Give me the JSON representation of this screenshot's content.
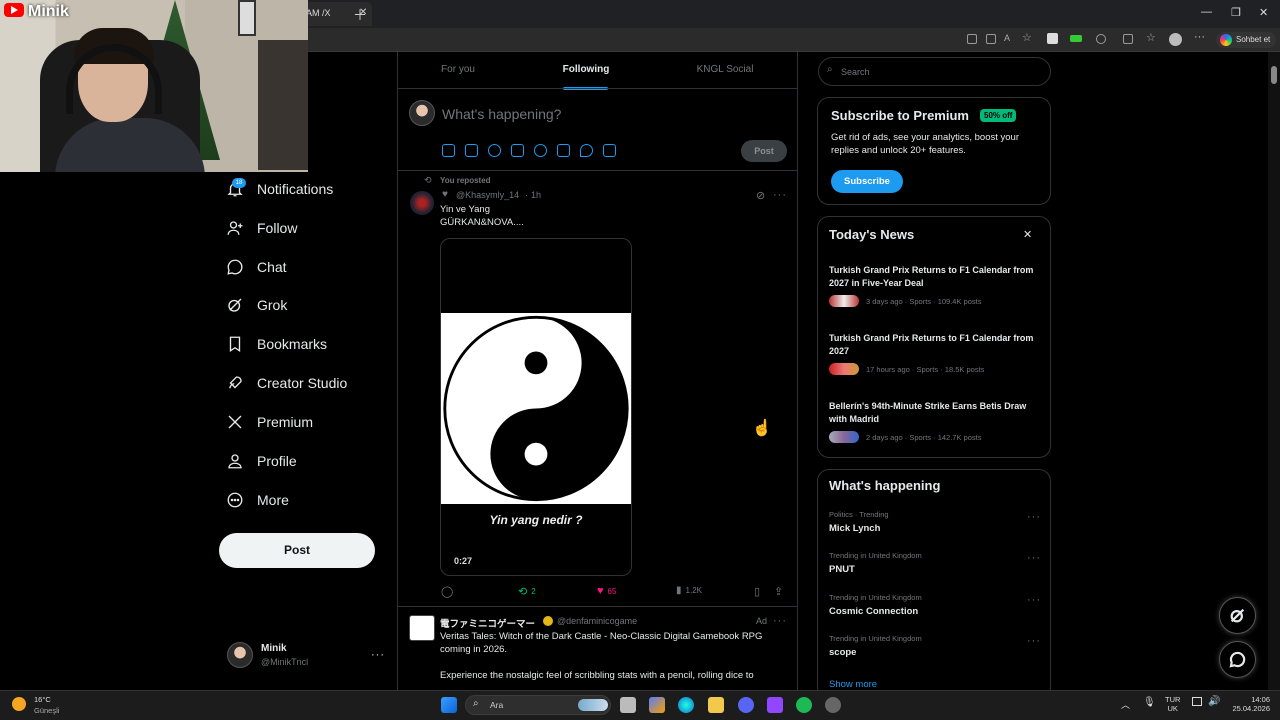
{
  "browser": {
    "tab_title": "AM /X",
    "copilot_label": "Sohbet et"
  },
  "stream": {
    "channel_name": "Minik"
  },
  "left_nav": {
    "items": [
      {
        "label": "Notifications",
        "icon": "bell-icon"
      },
      {
        "label": "Follow",
        "icon": "person-plus-icon"
      },
      {
        "label": "Chat",
        "icon": "chat-bubble-icon"
      },
      {
        "label": "Grok",
        "icon": "grok-icon"
      },
      {
        "label": "Bookmarks",
        "icon": "bookmark-icon"
      },
      {
        "label": "Creator Studio",
        "icon": "rocket-icon"
      },
      {
        "label": "Premium",
        "icon": "x-logo-icon"
      },
      {
        "label": "Profile",
        "icon": "person-icon"
      },
      {
        "label": "More",
        "icon": "more-circle-icon"
      }
    ],
    "notification_badge": "18",
    "post_button": "Post",
    "account": {
      "name": "Minik",
      "handle": "@MinikTncl"
    }
  },
  "feed": {
    "tabs": [
      "For you",
      "Following",
      "KNGL Social"
    ],
    "active_tab": "Following",
    "composer_placeholder": "What's happening?",
    "composer_post": "Post",
    "post1": {
      "repost_label": "You reposted",
      "handle": "@Khasymly_14",
      "time": "1h",
      "text_line1": "Yin ve Yang",
      "text_line2": "GÜRKAN&NOVA....",
      "video_caption": "Yin yang nedir ?",
      "video_duration": "0:27",
      "reposts": "2",
      "likes": "65",
      "views": "1.2K"
    },
    "post2": {
      "display_name": "電ファミニコゲーマー",
      "handle": "@denfaminicogame",
      "ad_label": "Ad",
      "text": "Veritas Tales: Witch of the Dark Castle - Neo-Classic Digital Gamebook RPG coming in 2026.",
      "text2": "Experience the nostalgic feel of scribbling stats with a pencil, rolling dice to"
    }
  },
  "right": {
    "search_placeholder": "Search",
    "premium": {
      "title": "Subscribe to Premium",
      "badge": "50% off",
      "body": "Get rid of ads, see your analytics, boost your replies and unlock 20+ features.",
      "button": "Subscribe"
    },
    "news": {
      "title": "Today's News",
      "items": [
        {
          "title": "Turkish Grand Prix Returns to F1 Calendar from 2027 in Five-Year Deal",
          "meta": "3 days ago · Sports · 109.4K posts"
        },
        {
          "title": "Turkish Grand Prix Returns to F1 Calendar from 2027",
          "meta": "17 hours ago · Sports · 18.5K posts"
        },
        {
          "title": "Bellerín's 94th-Minute Strike Earns Betis Draw with Madrid",
          "meta": "2 days ago · Sports · 142.7K posts"
        }
      ]
    },
    "happening": {
      "title": "What's happening",
      "items": [
        {
          "meta": "Politics · Trending",
          "title": "Mick Lynch"
        },
        {
          "meta": "Trending in United Kingdom",
          "title": "PNUT"
        },
        {
          "meta": "Trending in United Kingdom",
          "title": "Cosmic Connection"
        },
        {
          "meta": "Trending in United Kingdom",
          "title": "scope"
        }
      ],
      "show_more": "Show more"
    }
  },
  "taskbar": {
    "weather_temp": "16°C",
    "weather_desc": "Güneşli",
    "search_label": "Ara",
    "lang_line1": "TUR",
    "lang_line2": "UK",
    "time": "14:06",
    "date": "25.04.2026"
  },
  "colors": {
    "accent": "#1d9bf0",
    "premium_badge": "#00ba7c",
    "like": "#f91880",
    "repost": "#00ba7c"
  }
}
